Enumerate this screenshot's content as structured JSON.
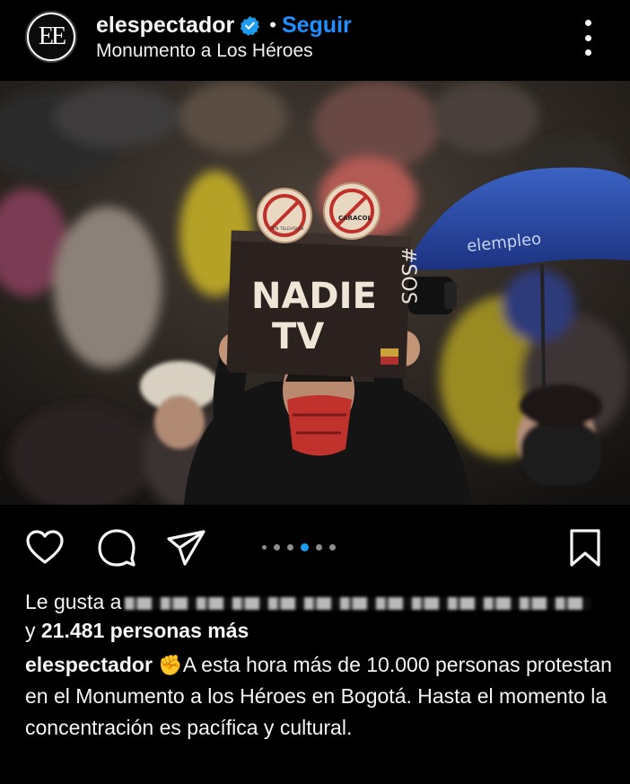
{
  "header": {
    "avatar_text": "EE",
    "username": "elespectador",
    "separator": "•",
    "follow_label": "Seguir",
    "location": "Monumento a Los Héroes"
  },
  "photo": {
    "sign_line1": "NADIE",
    "sign_line2": "TV",
    "sign_tag": "#SOS",
    "badge_left": "RCN TELEVISION",
    "badge_right": "CARACOL",
    "umbrella_text": "elempleo"
  },
  "actions": {
    "like_icon": "heart-icon",
    "comment_icon": "comment-icon",
    "share_icon": "send-icon",
    "save_icon": "bookmark-icon",
    "carousel_active_index": 3,
    "carousel_count": 5
  },
  "likes": {
    "prefix": "Le gusta a",
    "line2_prefix": "y",
    "count": "21.481 personas más"
  },
  "caption": {
    "username": "elespectador",
    "emoji": "✊",
    "text": "A esta hora más de 10.000 personas protestan en el Monumento a los Héroes en Bogotá. Hasta el momento la concentración es pacífica y cultural."
  },
  "colors": {
    "background": "#000000",
    "link_blue": "#1e90ff",
    "active_dot": "#1d9bf0"
  }
}
